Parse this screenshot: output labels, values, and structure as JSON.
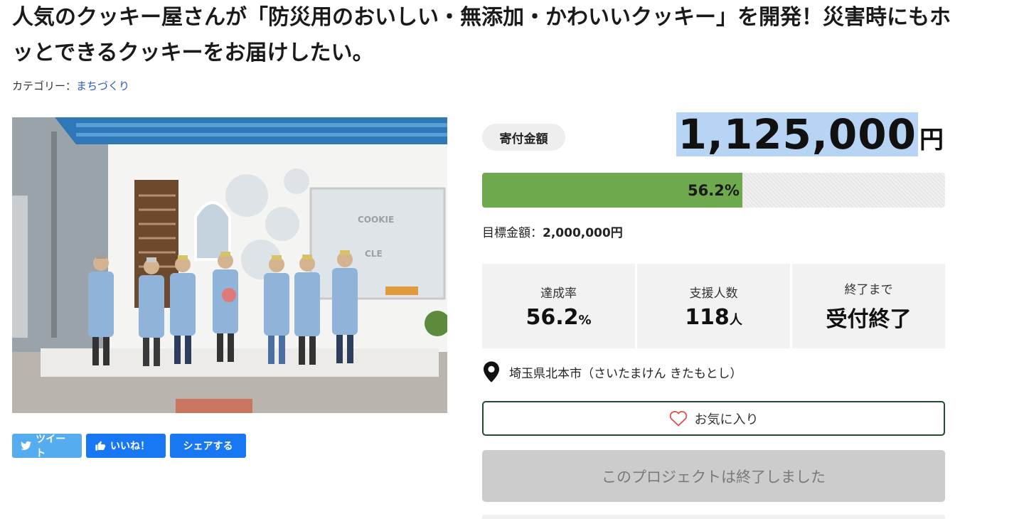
{
  "project": {
    "title": "人気のクッキー屋さんが「防災用のおいしい・無添加・かわいいクッキー」を開発！災害時にもホッとできるクッキーをお届けしたい。",
    "category_label": "カテゴリー：",
    "category_value": "まちづくり"
  },
  "photo": {
    "sign_lines": [
      "COOKIE",
      "CLE"
    ]
  },
  "share": {
    "tweet": "ツイート",
    "like": "いいね！",
    "share": "シェアする"
  },
  "funding": {
    "label": "寄付金額",
    "amount": "1,125,000",
    "unit": "円",
    "progress_text": "56.2%",
    "progress_fraction": 0.562,
    "target_label": "目標金額：",
    "target_value": "2,000,000円"
  },
  "stats": [
    {
      "label": "達成率",
      "value": "56.2",
      "unit": "%"
    },
    {
      "label": "支援人数",
      "value": "118",
      "unit": "人"
    },
    {
      "label": "終了まで",
      "value": "受付終了",
      "unit": ""
    }
  ],
  "location": {
    "text": "埼玉県北本市（さいたまけん きたもとし）",
    "icon": "map-pin-icon"
  },
  "buttons": {
    "favorite": "お気に入り",
    "ended": "このプロジェクトは終了しました"
  },
  "colors": {
    "progress_fill": "#6ea94d",
    "link": "#2b5bb8",
    "twitter": "#55acee",
    "facebook": "#1877f2",
    "heart": "#d9534f"
  }
}
